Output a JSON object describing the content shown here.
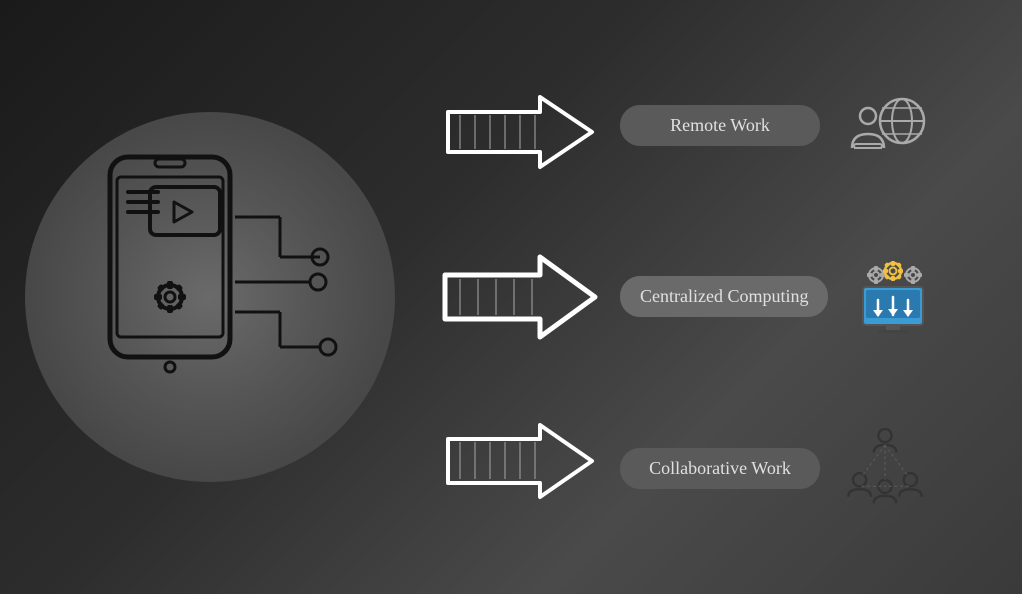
{
  "items": [
    {
      "label": "Remote Work",
      "active": false,
      "icon": "remote-work-icon"
    },
    {
      "label": "Centralized Computing",
      "active": true,
      "icon": "centralized-computing-icon"
    },
    {
      "label": "Collaborative Work",
      "active": false,
      "icon": "collaborative-work-icon"
    }
  ],
  "colors": {
    "background_start": "#1a1a1a",
    "background_end": "#4a4a4a",
    "circle_bg": "#555555",
    "pill_inactive": "#5a5a5a",
    "pill_active": "#6a6a6a",
    "text": "#e0e0e0"
  }
}
